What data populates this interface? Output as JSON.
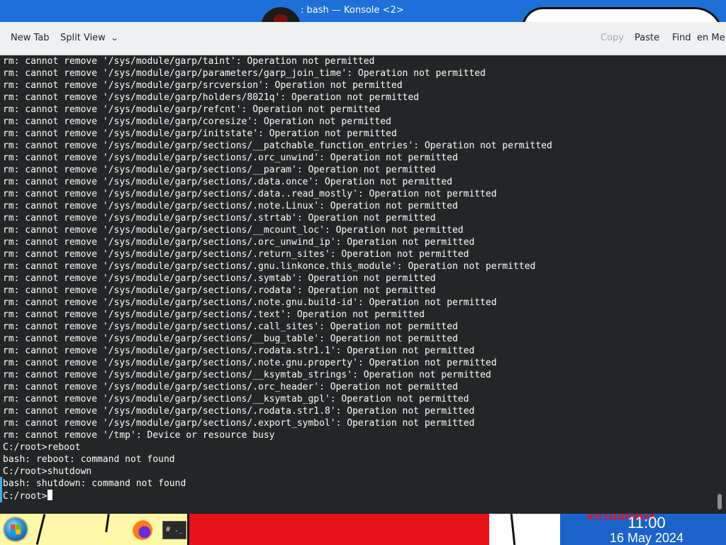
{
  "window": {
    "title": ": bash — Konsole <2>"
  },
  "toolbar": {
    "new_tab": "New Tab",
    "split_view": "Split View",
    "copy": "Copy",
    "paste": "Paste",
    "find": "Find",
    "menu": "en Me"
  },
  "terminal": {
    "lines": [
      "rm: cannot remove '/sys/module/garp/taint': Operation not permitted",
      "rm: cannot remove '/sys/module/garp/parameters/garp_join_time': Operation not permitted",
      "rm: cannot remove '/sys/module/garp/srcversion': Operation not permitted",
      "rm: cannot remove '/sys/module/garp/holders/8021q': Operation not permitted",
      "rm: cannot remove '/sys/module/garp/refcnt': Operation not permitted",
      "rm: cannot remove '/sys/module/garp/coresize': Operation not permitted",
      "rm: cannot remove '/sys/module/garp/initstate': Operation not permitted",
      "rm: cannot remove '/sys/module/garp/sections/__patchable_function_entries': Operation not permitted",
      "rm: cannot remove '/sys/module/garp/sections/.orc_unwind': Operation not permitted",
      "rm: cannot remove '/sys/module/garp/sections/__param': Operation not permitted",
      "rm: cannot remove '/sys/module/garp/sections/.data.once': Operation not permitted",
      "rm: cannot remove '/sys/module/garp/sections/.data..read_mostly': Operation not permitted",
      "rm: cannot remove '/sys/module/garp/sections/.note.Linux': Operation not permitted",
      "rm: cannot remove '/sys/module/garp/sections/.strtab': Operation not permitted",
      "rm: cannot remove '/sys/module/garp/sections/__mcount_loc': Operation not permitted",
      "rm: cannot remove '/sys/module/garp/sections/.orc_unwind_ip': Operation not permitted",
      "rm: cannot remove '/sys/module/garp/sections/.return_sites': Operation not permitted",
      "rm: cannot remove '/sys/module/garp/sections/.gnu.linkonce.this_module': Operation not permitted",
      "rm: cannot remove '/sys/module/garp/sections/.symtab': Operation not permitted",
      "rm: cannot remove '/sys/module/garp/sections/.rodata': Operation not permitted",
      "rm: cannot remove '/sys/module/garp/sections/.note.gnu.build-id': Operation not permitted",
      "rm: cannot remove '/sys/module/garp/sections/.text': Operation not permitted",
      "rm: cannot remove '/sys/module/garp/sections/.call_sites': Operation not permitted",
      "rm: cannot remove '/sys/module/garp/sections/__bug_table': Operation not permitted",
      "rm: cannot remove '/sys/module/garp/sections/.rodata.str1.1': Operation not permitted",
      "rm: cannot remove '/sys/module/garp/sections/.note.gnu.property': Operation not permitted",
      "rm: cannot remove '/sys/module/garp/sections/__ksymtab_strings': Operation not permitted",
      "rm: cannot remove '/sys/module/garp/sections/.orc_header': Operation not permitted",
      "rm: cannot remove '/sys/module/garp/sections/__ksymtab_gpl': Operation not permitted",
      "rm: cannot remove '/sys/module/garp/sections/.rodata.str1.8': Operation not permitted",
      "rm: cannot remove '/sys/module/garp/sections/.export_symbol': Operation not permitted",
      "rm: cannot remove '/tmp': Device or resource busy",
      "C:/root>reboot",
      "bash: reboot: command not found",
      "C:/root>shutdown",
      "bash: shutdown: command not found"
    ],
    "prompt": "C:/root>"
  },
  "taskbar": {
    "konsole_icon_text": "# ._",
    "vbox_text": "VirtualBox",
    "clock_time": "11:00",
    "clock_date": "16 May 2024"
  },
  "colors": {
    "terminal_bg": "#232627",
    "terminal_fg": "#fcfcfc",
    "toolbar_bg": "#eff0f1",
    "titlebar_bg": "#1e6fd8",
    "accent": "#3daee9"
  },
  "icons": {
    "chevron": "chevron-down-icon",
    "start": "windows-start-icon",
    "firefox": "firefox-icon",
    "konsole": "konsole-icon"
  }
}
